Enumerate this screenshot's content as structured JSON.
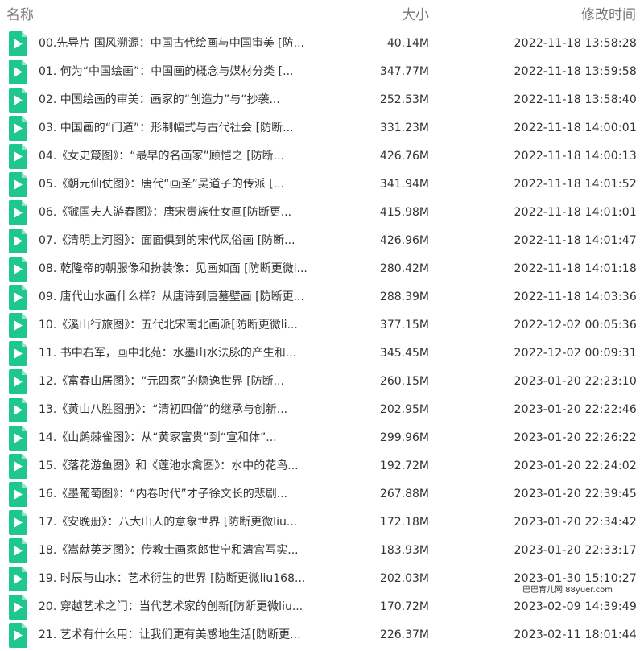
{
  "header": {
    "name": "名称",
    "size": "大小",
    "modified": "修改时间"
  },
  "colors": {
    "icon_green": "#1ec88c"
  },
  "icon": "video-file-icon",
  "files": [
    {
      "name": "00.先导片 国风溯源：中国古代绘画与中国审美 [防...",
      "size": "40.14M",
      "time": "2022-11-18 13:58:28"
    },
    {
      "name": "01. 何为“中国绘画”：中国画的概念与媒材分类 [...",
      "size": "347.77M",
      "time": "2022-11-18 13:59:58"
    },
    {
      "name": "02. 中国绘画的审美：画家的“创造力”与“抄袭...",
      "size": "252.53M",
      "time": "2022-11-18 13:58:40"
    },
    {
      "name": "03. 中国画的“门道”：形制幅式与古代社会 [防断...",
      "size": "331.23M",
      "time": "2022-11-18 14:00:01"
    },
    {
      "name": "04.《女史箴图》：“最早的名画家”顾恺之 [防断...",
      "size": "426.76M",
      "time": "2022-11-18 14:00:13"
    },
    {
      "name": "05.《朝元仙仗图》：唐代“画圣”吴道子的传派 [...",
      "size": "341.94M",
      "time": "2022-11-18 14:01:52"
    },
    {
      "name": "06.《虢国夫人游春图》：唐宋贵族仕女画[防断更...",
      "size": "415.98M",
      "time": "2022-11-18 14:01:01"
    },
    {
      "name": "07.《清明上河图》：面面俱到的宋代风俗画 [防断...",
      "size": "426.96M",
      "time": "2022-11-18 14:01:47"
    },
    {
      "name": "08. 乾隆帝的朝服像和扮装像：见画如面 [防断更微l...",
      "size": "280.42M",
      "time": "2022-11-18 14:01:18"
    },
    {
      "name": "09. 唐代山水画什么样？从唐诗到唐墓壁画 [防断更...",
      "size": "288.39M",
      "time": "2022-11-18 14:03:36"
    },
    {
      "name": "10.《溪山行旅图》：五代北宋南北画派[防断更微li...",
      "size": "377.15M",
      "time": "2022-12-02 00:05:36"
    },
    {
      "name": "11. 书中右军，画中北苑：水墨山水法脉的产生和...",
      "size": "345.45M",
      "time": "2022-12-02 00:09:31"
    },
    {
      "name": "12.《富春山居图》：“元四家”的隐逸世界 [防断...",
      "size": "260.15M",
      "time": "2023-01-20 22:23:10"
    },
    {
      "name": "13.《黄山八胜图册》：“清初四僧”的继承与创新...",
      "size": "202.95M",
      "time": "2023-01-20 22:22:46"
    },
    {
      "name": "14.《山鹧棘雀图》：从“黄家富贵”到“宣和体”...",
      "size": "299.96M",
      "time": "2023-01-20 22:26:22"
    },
    {
      "name": "15.《落花游鱼图》和《莲池水禽图》：水中的花鸟...",
      "size": "192.72M",
      "time": "2023-01-20 22:24:02"
    },
    {
      "name": "16.《墨葡萄图》：“内卷时代”才子徐文长的悲剧...",
      "size": "267.88M",
      "time": "2023-01-20 22:39:45"
    },
    {
      "name": "17.《安晚册》：八大山人的意象世界 [防断更微liu...",
      "size": "172.18M",
      "time": "2023-01-20 22:34:42"
    },
    {
      "name": "18.《嵩献英芝图》：传教士画家郎世宁和清宫写实...",
      "size": "183.93M",
      "time": "2023-01-20 22:33:17"
    },
    {
      "name": "19. 时辰与山水：艺术衍生的世界 [防断更微liu168...",
      "size": "202.03M",
      "time": "2023-01-30 15:10:27"
    },
    {
      "name": "20. 穿越艺术之门：当代艺术家的创新[防断更微liu...",
      "size": "170.72M",
      "time": "2023-02-09 14:39:49"
    },
    {
      "name": "21. 艺术有什么用：让我们更有美感地生活[防断更...",
      "size": "226.37M",
      "time": "2023-02-11 18:01:44"
    }
  ],
  "watermark": "巴巴育儿网 88yuer.com"
}
